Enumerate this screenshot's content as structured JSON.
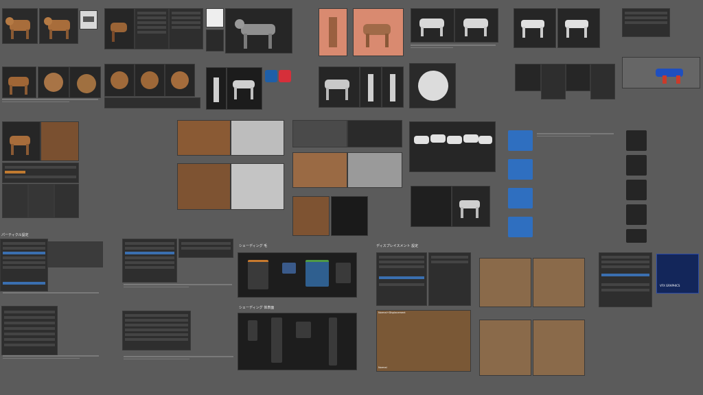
{
  "sections": {
    "particles": "パーティクル設定",
    "shading_hair": "シェーディング 毛",
    "shading_body": "シェーディング 体表面",
    "displacement": "ディスプレイスメント 設定",
    "final_label": "VFX GRAPHICS"
  },
  "render_labels": {
    "normal_displacement": "Normal+Displacement",
    "normal": "Normal"
  },
  "colors": {
    "background": "#5b5b5b",
    "accent_blue": "#2f6fc0",
    "node_orange": "#c87a2e",
    "node_green": "#4f9a45",
    "fur_brown": "#8a5a33",
    "clay_white": "#d9d9d9"
  }
}
